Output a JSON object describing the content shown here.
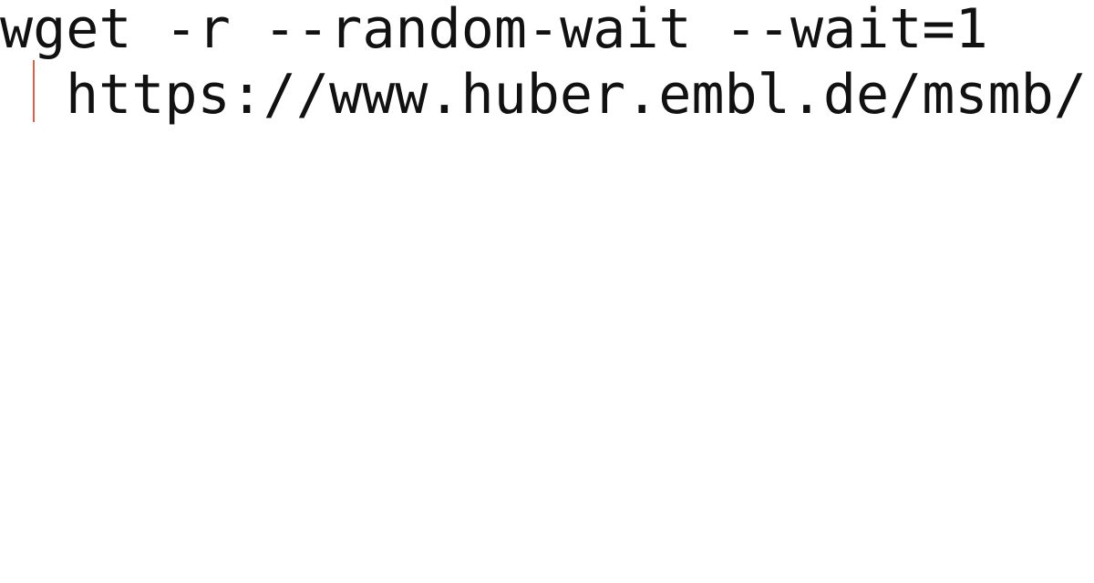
{
  "code": {
    "line1": "wget -r --random-wait --wait=1",
    "line2": "https://www.huber.embl.de/msmb/"
  },
  "colors": {
    "text": "#111111",
    "continuation_marker": "#d9604a",
    "background": "#ffffff"
  }
}
